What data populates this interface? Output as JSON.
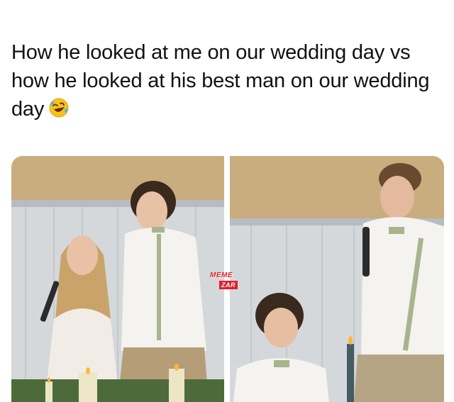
{
  "post": {
    "caption": "How he looked at me on our wedding day vs how he looked at his best man on our wedding day",
    "emoji_name": "rolling-on-floor-laughing-emoji"
  },
  "images": {
    "left": {
      "subject": "bride-with-microphone-and-groom"
    },
    "right": {
      "subject": "groom-with-microphone-and-best-man"
    }
  },
  "watermark": {
    "line1": "MEME",
    "line2": "ZAR",
    "color": "#e11d2b"
  }
}
